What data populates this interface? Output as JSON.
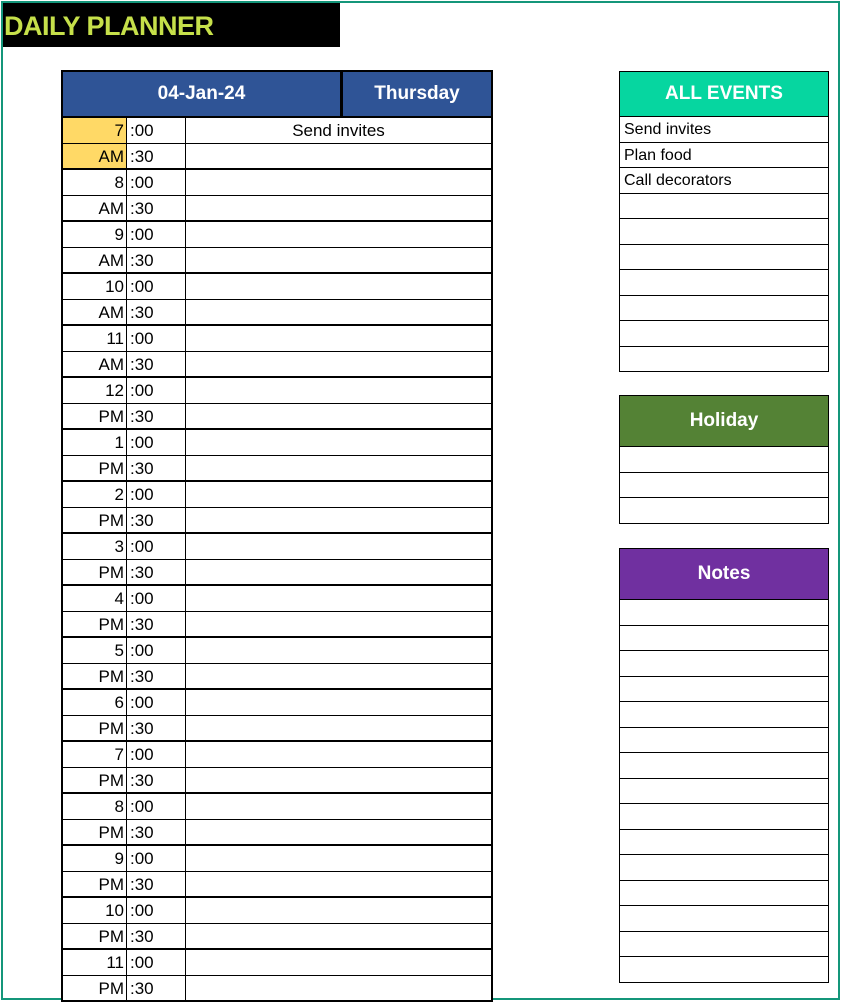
{
  "title": "DAILY PLANNER",
  "planner": {
    "date": "04-Jan-24",
    "day": "Thursday",
    "highlight_color": "#ffd966",
    "header_color": "#2f5496",
    "hours": [
      {
        "hour": "7",
        "period": "AM",
        "slot_00": "Send invites",
        "slot_30": "",
        "highlighted": true
      },
      {
        "hour": "8",
        "period": "AM",
        "slot_00": "",
        "slot_30": ""
      },
      {
        "hour": "9",
        "period": "AM",
        "slot_00": "",
        "slot_30": ""
      },
      {
        "hour": "10",
        "period": "AM",
        "slot_00": "",
        "slot_30": ""
      },
      {
        "hour": "11",
        "period": "AM",
        "slot_00": "",
        "slot_30": ""
      },
      {
        "hour": "12",
        "period": "PM",
        "slot_00": "",
        "slot_30": ""
      },
      {
        "hour": "1",
        "period": "PM",
        "slot_00": "",
        "slot_30": ""
      },
      {
        "hour": "2",
        "period": "PM",
        "slot_00": "",
        "slot_30": ""
      },
      {
        "hour": "3",
        "period": "PM",
        "slot_00": "",
        "slot_30": ""
      },
      {
        "hour": "4",
        "period": "PM",
        "slot_00": "",
        "slot_30": ""
      },
      {
        "hour": "5",
        "period": "PM",
        "slot_00": "",
        "slot_30": ""
      },
      {
        "hour": "6",
        "period": "PM",
        "slot_00": "",
        "slot_30": ""
      },
      {
        "hour": "7",
        "period": "PM",
        "slot_00": "",
        "slot_30": ""
      },
      {
        "hour": "8",
        "period": "PM",
        "slot_00": "",
        "slot_30": ""
      },
      {
        "hour": "9",
        "period": "PM",
        "slot_00": "",
        "slot_30": ""
      },
      {
        "hour": "10",
        "period": "PM",
        "slot_00": "",
        "slot_30": ""
      },
      {
        "hour": "11",
        "period": "PM",
        "slot_00": "",
        "slot_30": ""
      }
    ],
    "min_00": ":00",
    "min_30": ":30"
  },
  "all_events": {
    "title": "ALL EVENTS",
    "color": "#06d6a0",
    "items": [
      "Send invites",
      "Plan food",
      "Call decorators",
      "",
      "",
      "",
      "",
      "",
      "",
      ""
    ]
  },
  "holiday": {
    "title": "Holiday",
    "color": "#548235",
    "items": [
      "",
      "",
      ""
    ]
  },
  "notes": {
    "title": "Notes",
    "color": "#7030a0",
    "items": [
      "",
      "",
      "",
      "",
      "",
      "",
      "",
      "",
      "",
      "",
      "",
      "",
      "",
      "",
      ""
    ]
  }
}
